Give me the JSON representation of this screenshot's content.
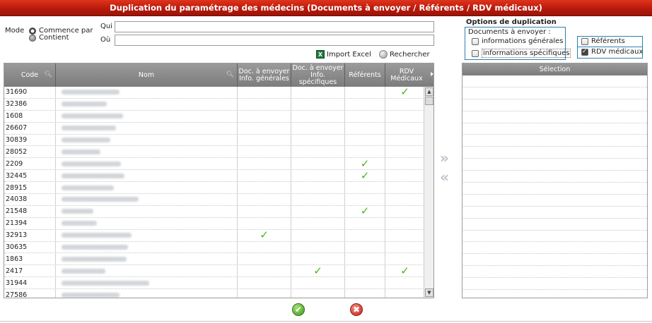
{
  "window": {
    "title": "Duplication du paramétrage des médecins (Documents à envoyer / Référents / RDV médicaux)"
  },
  "filters": {
    "mode_label": "Mode",
    "options": [
      "Commence par",
      "Contient"
    ],
    "selected": "Commence par",
    "qui_label": "Qui",
    "qui_value": "",
    "ou_label": "Où",
    "ou_value": ""
  },
  "toolbar": {
    "import_label": "Import Excel",
    "search_label": "Rechercher"
  },
  "grid": {
    "columns": [
      "Code",
      "Nom",
      "Doc. à envoyer Info. générales",
      "Doc. à envoyer Info. spécifiques",
      "Référents",
      "RDV Médicaux"
    ],
    "rows": [
      {
        "code": "31690",
        "nom_w": 0.33,
        "d1": false,
        "d2": false,
        "ref": false,
        "rdv": true
      },
      {
        "code": "32386",
        "nom_w": 0.26,
        "d1": false,
        "d2": false,
        "ref": false,
        "rdv": false
      },
      {
        "code": "1608",
        "nom_w": 0.35,
        "d1": false,
        "d2": false,
        "ref": false,
        "rdv": false
      },
      {
        "code": "26607",
        "nom_w": 0.31,
        "d1": false,
        "d2": false,
        "ref": false,
        "rdv": false
      },
      {
        "code": "30839",
        "nom_w": 0.28,
        "d1": false,
        "d2": false,
        "ref": false,
        "rdv": false
      },
      {
        "code": "28052",
        "nom_w": 0.22,
        "d1": false,
        "d2": false,
        "ref": false,
        "rdv": false
      },
      {
        "code": "2209",
        "nom_w": 0.34,
        "d1": false,
        "d2": false,
        "ref": true,
        "rdv": false
      },
      {
        "code": "32445",
        "nom_w": 0.36,
        "d1": false,
        "d2": false,
        "ref": true,
        "rdv": false
      },
      {
        "code": "28915",
        "nom_w": 0.3,
        "d1": false,
        "d2": false,
        "ref": false,
        "rdv": false
      },
      {
        "code": "24038",
        "nom_w": 0.44,
        "d1": false,
        "d2": false,
        "ref": false,
        "rdv": false
      },
      {
        "code": "21548",
        "nom_w": 0.18,
        "d1": false,
        "d2": false,
        "ref": true,
        "rdv": false
      },
      {
        "code": "21394",
        "nom_w": 0.2,
        "d1": false,
        "d2": false,
        "ref": false,
        "rdv": false
      },
      {
        "code": "32913",
        "nom_w": 0.4,
        "d1": true,
        "d2": false,
        "ref": false,
        "rdv": false
      },
      {
        "code": "30635",
        "nom_w": 0.38,
        "d1": false,
        "d2": false,
        "ref": false,
        "rdv": false
      },
      {
        "code": "1863",
        "nom_w": 0.37,
        "d1": false,
        "d2": false,
        "ref": false,
        "rdv": false
      },
      {
        "code": "2417",
        "nom_w": 0.25,
        "d1": false,
        "d2": true,
        "ref": false,
        "rdv": true
      },
      {
        "code": "31944",
        "nom_w": 0.5,
        "d1": false,
        "d2": false,
        "ref": false,
        "rdv": false
      },
      {
        "code": "27586",
        "nom_w": 0.33,
        "d1": false,
        "d2": false,
        "ref": false,
        "rdv": false
      }
    ]
  },
  "options": {
    "title": "Options de duplication",
    "docs_label": "Documents à envoyer :",
    "info_generales": {
      "label": "informations générales",
      "checked": false
    },
    "info_specifiques": {
      "label": "informations spécifiques",
      "checked": false
    },
    "referents": {
      "label": "Référents",
      "checked": false
    },
    "rdv_medicaux": {
      "label": "RDV médicaux",
      "checked": true
    }
  },
  "selection": {
    "header": "Sélection"
  },
  "colors": {
    "title_bar": "#c8230f",
    "grid_header": "#8a8a8a",
    "check": "#46b51e",
    "focus_border": "#2e7fb0"
  }
}
